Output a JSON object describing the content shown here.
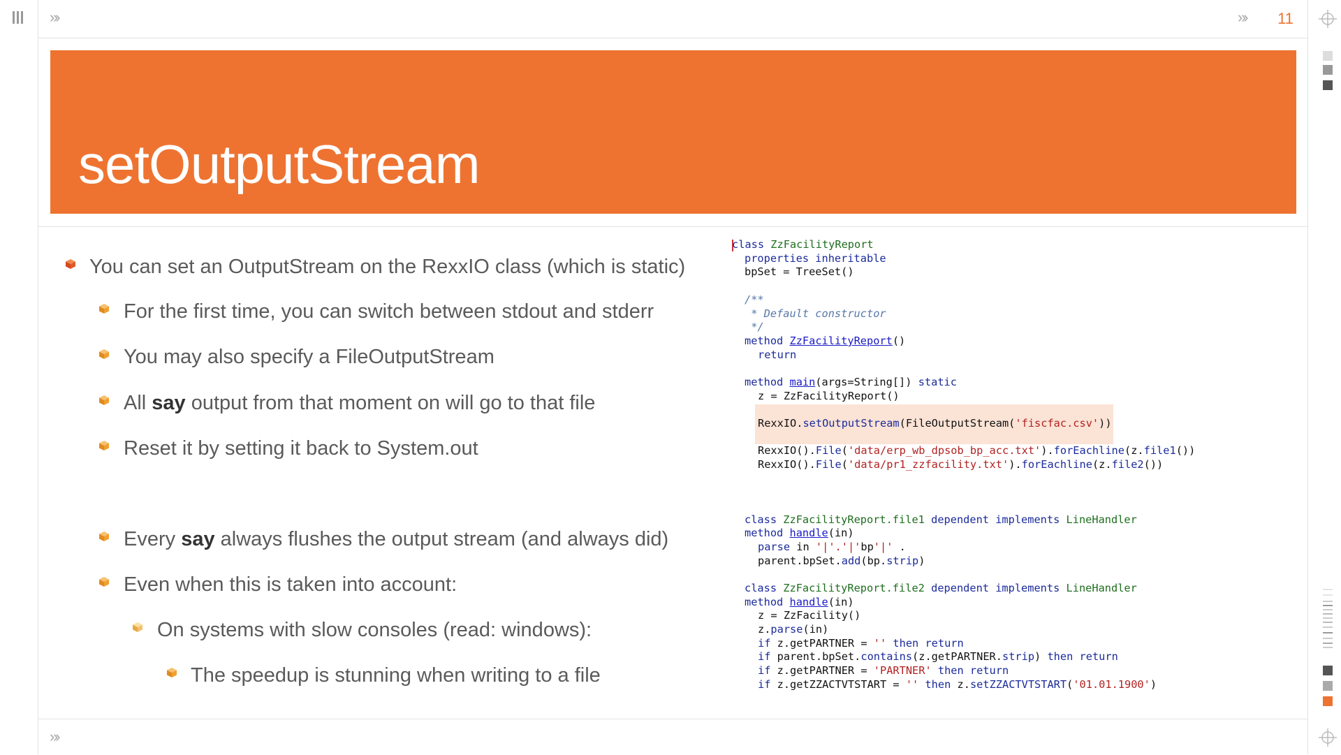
{
  "slide": {
    "title": "setOutputStream",
    "page_number": "11"
  },
  "nav": {
    "top_left_chevron": "»›",
    "top_right_chevron": "»›",
    "bottom_left_chevron": "»›"
  },
  "colors": {
    "accent": "#ee7331",
    "bullet_level1": "#e05a2a",
    "bullet_level2": "#f0a030",
    "bullet_level3": "#f5c070"
  },
  "bullets": [
    {
      "level": 1,
      "parts": [
        "You can set an OutputStream on the RexxIO class (which is static)"
      ]
    },
    {
      "level": 2,
      "parts": [
        "For the first time, you can switch between stdout and stderr"
      ]
    },
    {
      "level": 2,
      "parts": [
        "You may also specify a FileOutputStream"
      ]
    },
    {
      "level": 2,
      "parts": [
        "All ",
        "say",
        " output from that moment on will go to that file"
      ]
    },
    {
      "level": 2,
      "parts": [
        "Reset it by setting it back to System.out"
      ]
    },
    {
      "level": 2,
      "parts": [
        "Every ",
        "say",
        " always flushes the output stream (and always did)"
      ]
    },
    {
      "level": 2,
      "parts": [
        "Even when this is taken into account:"
      ]
    },
    {
      "level": 3,
      "parts": [
        "On systems with slow consoles (read: windows):"
      ]
    },
    {
      "level": 4,
      "parts": [
        "The speedup is stunning when writing to a file"
      ]
    }
  ],
  "code": {
    "l01_kw": "class",
    "l01_cl": "ZzFacilityReport",
    "l02_kw": "properties inheritable",
    "l03": "bpSet = TreeSet()",
    "l04": "/**",
    "l05": " * Default constructor",
    "l06": " */",
    "l07_kw": "method",
    "l07_lk": "ZzFacilityReport",
    "l07_tail": "()",
    "l08_kw": "return",
    "l09_kw": "method",
    "l09_lk": "main",
    "l09_mid": "(args=String[])",
    "l09_kw2": "static",
    "l10": "z = ZzFacilityReport()",
    "l11_a": "RexxIO.",
    "l11_m": "setOutputStream",
    "l11_b": "(FileOutputStream(",
    "l11_s": "'fiscfac.csv'",
    "l11_c": "))",
    "l12_a": "RexxIO().",
    "l12_m1": "File",
    "l12_b": "(",
    "l12_s": "'data/erp_wb_dpsob_bp_acc.txt'",
    "l12_c": ").",
    "l12_m2": "forEachline",
    "l12_d": "(z.",
    "l12_m3": "file1",
    "l12_e": "())",
    "l13_a": "RexxIO().",
    "l13_m1": "File",
    "l13_b": "(",
    "l13_s": "'data/pr1_zzfacility.txt'",
    "l13_c": ").",
    "l13_m2": "forEachline",
    "l13_d": "(z.",
    "l13_m3": "file2",
    "l13_e": "())",
    "l14_kw": "class",
    "l14_cl": "ZzFacilityReport.file1",
    "l14_kw2": "dependent implements",
    "l14_cl2": "LineHandler",
    "l15_kw": "method",
    "l15_lk": "handle",
    "l15_tail": "(in)",
    "l16_kw": "parse",
    "l16_mid": " in ",
    "l16_s": "'|'.'|'",
    "l16_mid2": "bp",
    "l16_s2": "'|'",
    "l16_end": " .",
    "l17_a": "parent.bpSet.",
    "l17_m": "add",
    "l17_b": "(bp.",
    "l17_m2": "strip",
    "l17_c": ")",
    "l18_kw": "class",
    "l18_cl": "ZzFacilityReport.file2",
    "l18_kw2": "dependent implements",
    "l18_cl2": "LineHandler",
    "l19_kw": "method",
    "l19_lk": "handle",
    "l19_tail": "(in)",
    "l20": "z = ZzFacility()",
    "l21_a": "z.",
    "l21_m": "parse",
    "l21_b": "(in)",
    "l22_kw": "if",
    "l22_a": " z.getPARTNER = ",
    "l22_s": "''",
    "l22_kw2": " then return",
    "l23_kw": "if",
    "l23_a": " parent.bpSet.",
    "l23_m": "contains",
    "l23_b": "(z.getPARTNER.",
    "l23_m2": "strip",
    "l23_c": ")",
    "l23_kw2": " then return",
    "l24_kw": "if",
    "l24_a": " z.getPARTNER = ",
    "l24_s": "'PARTNER'",
    "l24_kw2": " then return",
    "l25_kw": "if",
    "l25_a": " z.getZZACTVTSTART = ",
    "l25_s": "''",
    "l25_kw2": " then",
    "l25_b": " z.",
    "l25_m": "setZZACTVTSTART",
    "l25_c": "(",
    "l25_s2": "'01.01.1900'",
    "l25_d": ")"
  }
}
